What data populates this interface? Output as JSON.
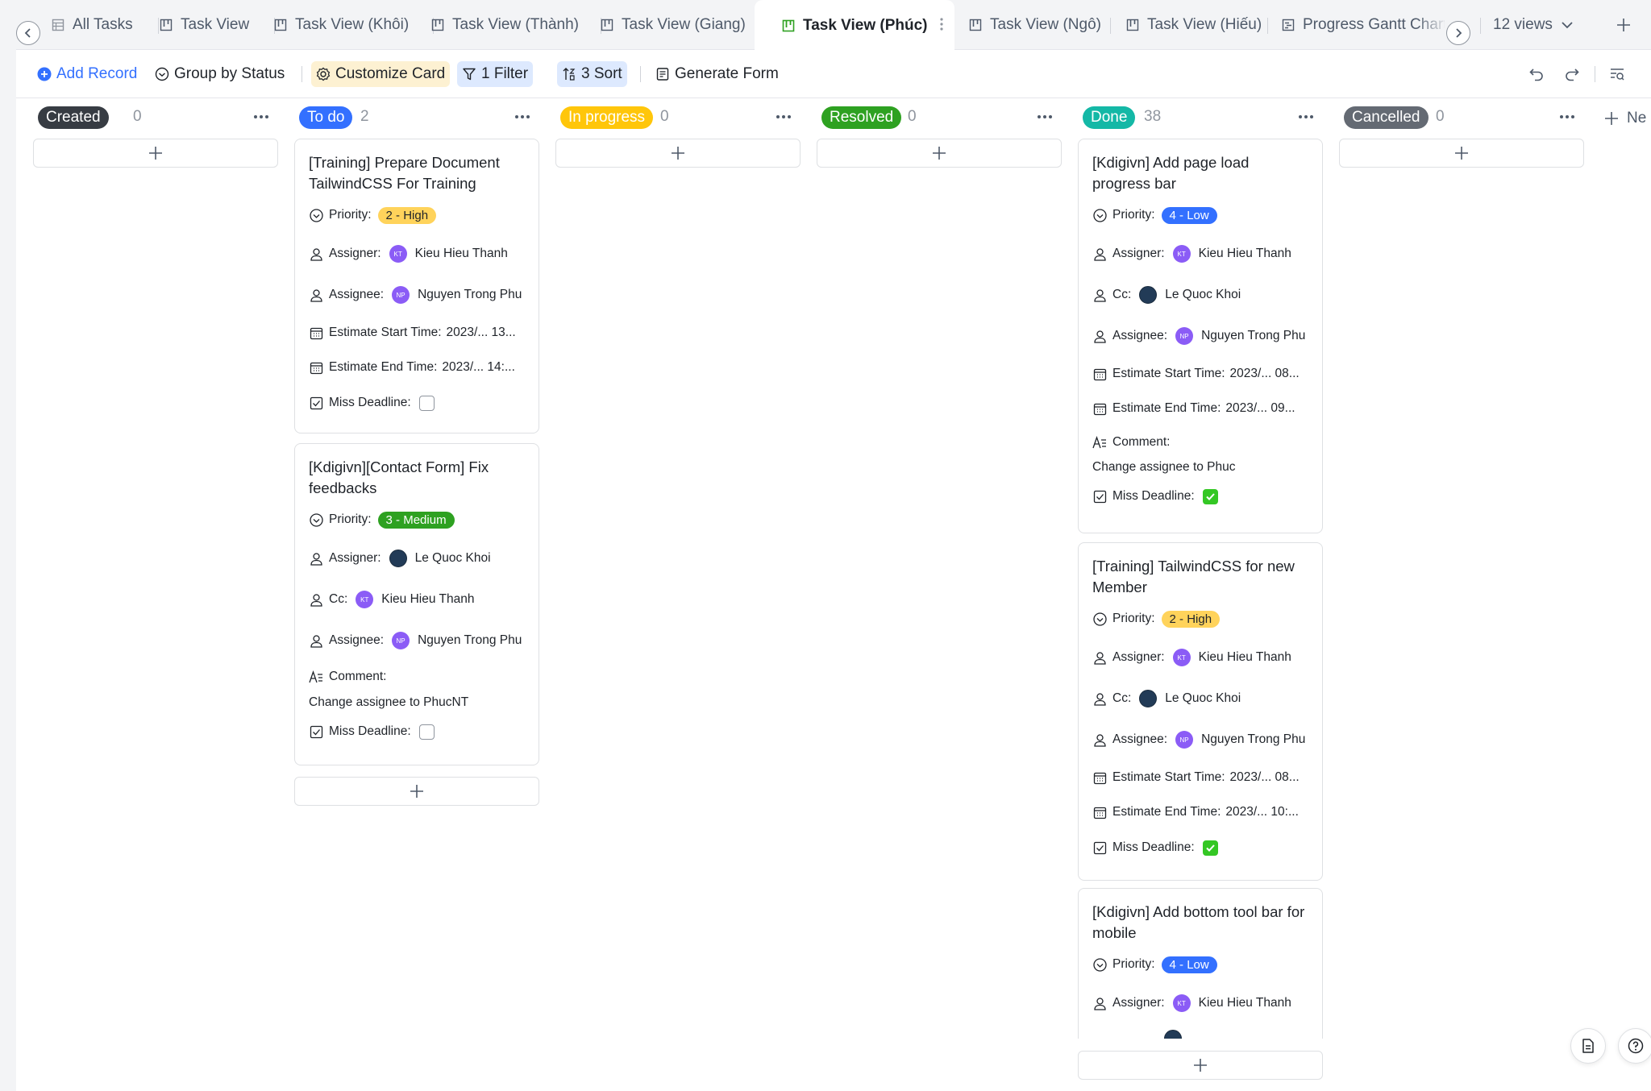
{
  "tabs": [
    {
      "label": "All Tasks",
      "icon": "grid-view-icon"
    },
    {
      "label": "Task View",
      "icon": "kanban-icon"
    },
    {
      "label": "Task View (Khôi)",
      "icon": "kanban-icon"
    },
    {
      "label": "Task View (Thành)",
      "icon": "kanban-icon"
    },
    {
      "label": "Task View (Giang)",
      "icon": "kanban-icon"
    },
    {
      "label": "Task View (Phúc)",
      "icon": "kanban-icon",
      "active": true
    },
    {
      "label": "Task View (Ngô)",
      "icon": "kanban-icon"
    },
    {
      "label": "Task View (Hiếu)",
      "icon": "kanban-icon"
    },
    {
      "label": "Progress Gantt Chart",
      "icon": "gantt-icon"
    }
  ],
  "views_count": "12 views",
  "toolbar": {
    "add_record": "Add Record",
    "group_by": "Group by Status",
    "customize_card": "Customize Card",
    "filter": "1 Filter",
    "sort": "3 Sort",
    "generate_form": "Generate Form"
  },
  "columns": [
    {
      "name": "Created",
      "count": "0",
      "color": "#373c43"
    },
    {
      "name": "To do",
      "count": "2",
      "color": "#3370ff"
    },
    {
      "name": "In progress",
      "count": "0",
      "color": "#ffc60a"
    },
    {
      "name": "Resolved",
      "count": "0",
      "color": "#2ea121"
    },
    {
      "name": "Done",
      "count": "38",
      "color": "#14b8a6"
    },
    {
      "name": "Cancelled",
      "count": "0",
      "color": "#646a73"
    }
  ],
  "new_group_label": "Ne",
  "labels": {
    "priority": "Priority:",
    "assigner": "Assigner:",
    "assignee": "Assignee:",
    "cc": "Cc:",
    "start": "Estimate Start Time:",
    "end": "Estimate End Time:",
    "comment": "Comment:",
    "miss": "Miss Deadline:"
  },
  "cards": {
    "todo1": {
      "title": "[Training] Prepare Document TailwindCSS For Training",
      "priority": "2 - High",
      "assigner": "Kieu Hieu Thanh",
      "assigner_initials": "KT",
      "assignee": "Nguyen Trong Phu",
      "assignee_initials": "NP",
      "start": "2023/...  13...",
      "end": "2023/...  14:..."
    },
    "todo2": {
      "title": "[Kdigivn][Contact Form] Fix feedbacks",
      "priority": "3 - Medium",
      "assigner": "Le Quoc Khoi",
      "cc": "Kieu Hieu Thanh",
      "cc_initials": "KT",
      "assignee": "Nguyen Trong Phu",
      "assignee_initials": "NP",
      "comment": "Change assignee to PhucNT"
    },
    "done1": {
      "title": "[Kdigivn] Add page load progress bar",
      "priority": "4 - Low",
      "assigner": "Kieu Hieu Thanh",
      "assigner_initials": "KT",
      "cc": "Le Quoc Khoi",
      "assignee": "Nguyen Trong Phu",
      "assignee_initials": "NP",
      "start": "2023/...  08...",
      "end": "2023/...  09...",
      "comment": "Change assignee to Phuc"
    },
    "done2": {
      "title": "[Training] TailwindCSS for new Member",
      "priority": "2 - High",
      "assigner": "Kieu Hieu Thanh",
      "assigner_initials": "KT",
      "cc": "Le Quoc Khoi",
      "assignee": "Nguyen Trong Phu",
      "assignee_initials": "NP",
      "start": "2023/...  08...",
      "end": "2023/...  10:..."
    },
    "done3": {
      "title": "[Kdigivn] Add bottom tool bar for mobile",
      "priority": "4 - Low",
      "assigner": "Kieu Hieu Thanh",
      "assigner_initials": "KT"
    }
  }
}
